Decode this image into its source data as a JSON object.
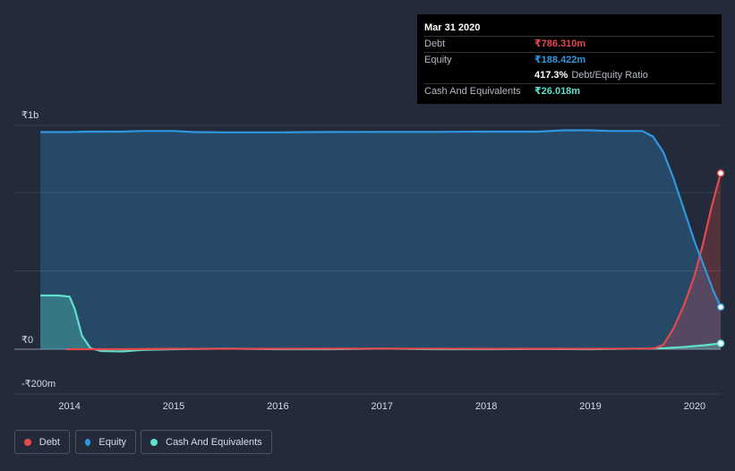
{
  "tooltip": {
    "date": "Mar 31 2020",
    "rows": [
      {
        "label": "Debt",
        "value": "₹786.310m",
        "color": "#e5484d"
      },
      {
        "label": "Equity",
        "value": "₹188.422m",
        "color": "#2f97e0"
      },
      {
        "label": "",
        "value": "417.3%",
        "extra": "Debt/Equity Ratio",
        "color": "#ffffff"
      },
      {
        "label": "Cash And Equivalents",
        "value": "₹26.018m",
        "color": "#5ee0cc"
      }
    ]
  },
  "legend": [
    {
      "label": "Debt",
      "color": "#e5484d"
    },
    {
      "label": "Equity",
      "color": "#2f97e0"
    },
    {
      "label": "Cash And Equivalents",
      "color": "#5ee0cc"
    }
  ],
  "chart_data": {
    "type": "area",
    "title": "",
    "xlabel": "",
    "ylabel": "",
    "y_unit": "₹ millions",
    "ylim": [
      -200,
      1000
    ],
    "xlim": [
      2013.47,
      2020.25
    ],
    "y_tick_labels": [
      {
        "value": 1000,
        "label": "₹1b"
      },
      {
        "value": 0,
        "label": "₹0"
      },
      {
        "value": -200,
        "label": "-₹200m"
      }
    ],
    "x_ticks": [
      2014,
      2015,
      2016,
      2017,
      2018,
      2019,
      2020
    ],
    "grid": true,
    "legend_position": "bottom-left",
    "series": [
      {
        "name": "Debt",
        "color": "#e5484d",
        "points": [
          [
            2013.97,
            0
          ],
          [
            2014.5,
            0
          ],
          [
            2015,
            2
          ],
          [
            2016,
            2
          ],
          [
            2017,
            3
          ],
          [
            2018,
            2
          ],
          [
            2019,
            2
          ],
          [
            2019.5,
            3
          ],
          [
            2019.62,
            5
          ],
          [
            2019.7,
            20
          ],
          [
            2019.8,
            95
          ],
          [
            2019.9,
            200
          ],
          [
            2020,
            330
          ],
          [
            2020.08,
            470
          ],
          [
            2020.16,
            630
          ],
          [
            2020.25,
            786.31
          ]
        ]
      },
      {
        "name": "Equity",
        "color": "#2f97e0",
        "points": [
          [
            2013.72,
            970
          ],
          [
            2014,
            970
          ],
          [
            2014.2,
            972
          ],
          [
            2014.5,
            972
          ],
          [
            2014.7,
            975
          ],
          [
            2015,
            975
          ],
          [
            2015.2,
            970
          ],
          [
            2015.5,
            969
          ],
          [
            2016,
            969
          ],
          [
            2016.3,
            970
          ],
          [
            2017,
            971
          ],
          [
            2017.5,
            971
          ],
          [
            2018,
            972
          ],
          [
            2018.5,
            972
          ],
          [
            2018.75,
            978
          ],
          [
            2019,
            978
          ],
          [
            2019.2,
            975
          ],
          [
            2019.5,
            975
          ],
          [
            2019.6,
            950
          ],
          [
            2019.7,
            880
          ],
          [
            2019.8,
            760
          ],
          [
            2019.9,
            620
          ],
          [
            2020,
            480
          ],
          [
            2020.1,
            360
          ],
          [
            2020.18,
            260
          ],
          [
            2020.25,
            188.422
          ]
        ]
      },
      {
        "name": "Cash And Equivalents",
        "color": "#5ee0cc",
        "points": [
          [
            2013.72,
            240
          ],
          [
            2013.9,
            240
          ],
          [
            2014,
            235
          ],
          [
            2014.05,
            180
          ],
          [
            2014.12,
            60
          ],
          [
            2014.2,
            5
          ],
          [
            2014.3,
            -8
          ],
          [
            2014.5,
            -10
          ],
          [
            2014.7,
            -3
          ],
          [
            2015,
            0
          ],
          [
            2015.5,
            3
          ],
          [
            2016,
            0
          ],
          [
            2016.5,
            0
          ],
          [
            2017,
            3
          ],
          [
            2017.5,
            0
          ],
          [
            2018,
            0
          ],
          [
            2018.5,
            1
          ],
          [
            2019,
            0
          ],
          [
            2019.5,
            3
          ],
          [
            2019.7,
            5
          ],
          [
            2019.9,
            10
          ],
          [
            2020.1,
            18
          ],
          [
            2020.25,
            26.018
          ]
        ]
      }
    ]
  }
}
